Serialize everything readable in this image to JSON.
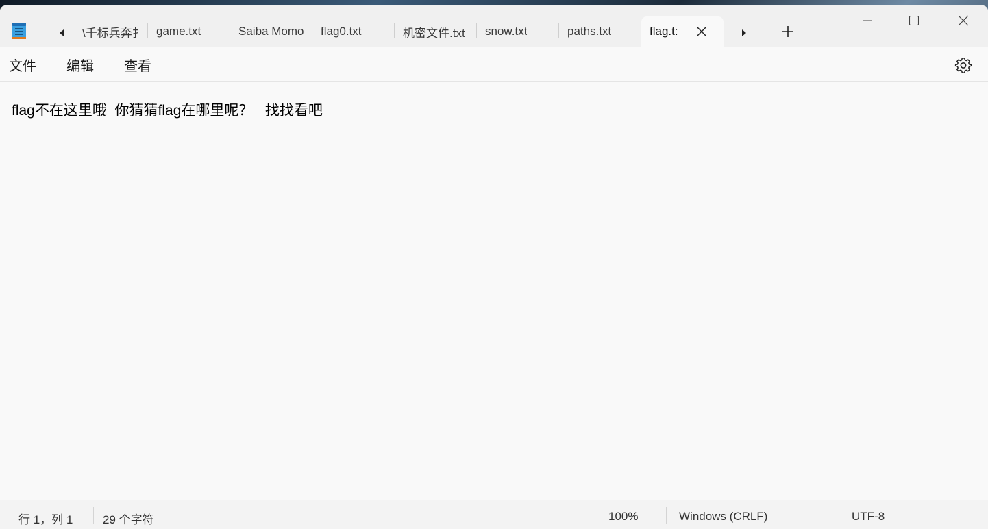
{
  "tabs": [
    {
      "label": "\\千标兵奔扌"
    },
    {
      "label": "game.txt"
    },
    {
      "label": "Saiba Momo"
    },
    {
      "label": "flag0.txt"
    },
    {
      "label": "机密文件.txt"
    },
    {
      "label": "snow.txt"
    },
    {
      "label": "paths.txt"
    },
    {
      "label": "flag.t:",
      "active": true
    }
  ],
  "menu": {
    "file": "文件",
    "edit": "编辑",
    "view": "查看"
  },
  "editor": {
    "content": "flag不在这里哦  你猜猜flag在哪里呢？   找找看吧"
  },
  "status": {
    "position": "行 1，列 1",
    "char_count": "29 个字符",
    "zoom": "100%",
    "line_ending": "Windows (CRLF)",
    "encoding": "UTF-8"
  },
  "icons": {
    "app": "notepad-icon",
    "scroll_left": "caret-left-icon",
    "scroll_right": "caret-right-icon",
    "new_tab": "plus-icon",
    "close_tab": "close-icon",
    "minimize": "minimize-icon",
    "maximize": "maximize-icon",
    "close_window": "close-icon",
    "settings": "gear-icon"
  },
  "colors": {
    "accent": "#0f6cbd",
    "window_bg": "#f9f9f9",
    "titlebar_bg": "#f0f0f0"
  }
}
